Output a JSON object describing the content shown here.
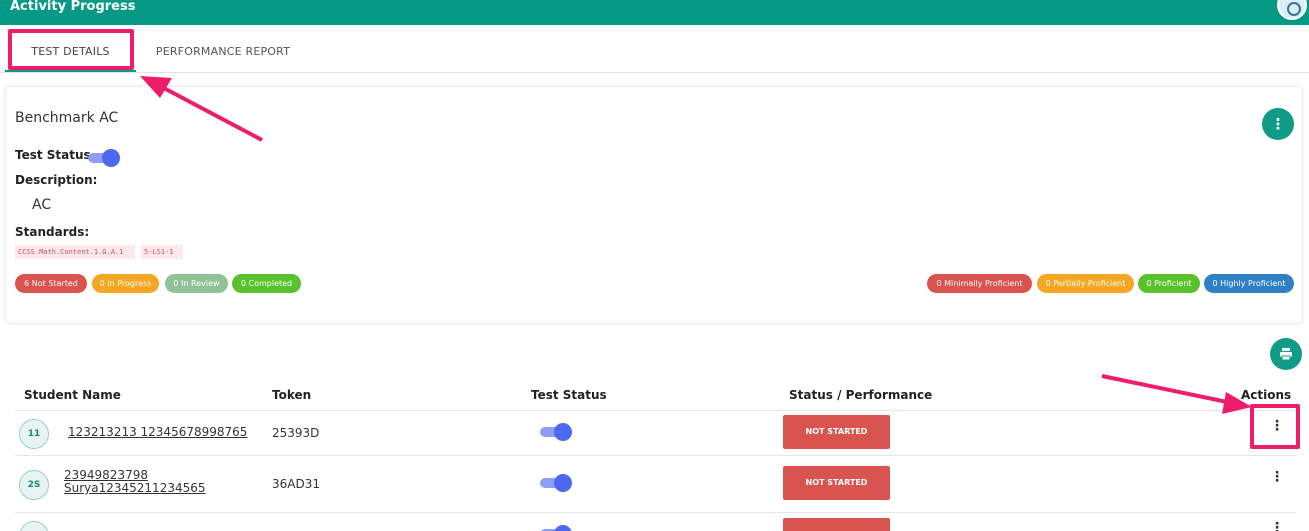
{
  "header": {
    "title": "Activity Progress",
    "avatar_icon": "user-avatar-icon"
  },
  "tabs": [
    {
      "label": "TEST DETAILS",
      "active": true
    },
    {
      "label": "PERFORMANCE REPORT",
      "active": false
    }
  ],
  "test": {
    "title": "Benchmark AC",
    "status_label": "Test Status",
    "status_on": true,
    "description_label": "Description:",
    "description": "AC",
    "standards_label": "Standards:",
    "standards": [
      "CCSS.Math.Content.1.G.A.1",
      "5-LS1-1"
    ]
  },
  "progress_badges": [
    "6 Not Started",
    "0 In Progress",
    "0 In Review",
    "0 Completed"
  ],
  "proficiency_badges": [
    "0 Minimally Proficient",
    "0 Partially Proficient",
    "0 Proficient",
    "0 Highly Proficient"
  ],
  "colors": {
    "accent": "#069a86",
    "not_started": "#d9534f",
    "in_progress": "#f5a623",
    "in_review": "#8fc397",
    "completed": "#57c22b",
    "highly_proficient": "#2f7fc4",
    "annotation": "#ee1d6b",
    "toggle": "#4f68f2"
  },
  "table": {
    "columns": [
      "Student Name",
      "Token",
      "Test Status",
      "Status / Performance",
      "Actions"
    ],
    "rows": [
      {
        "initials": "11",
        "name": "123213213 12345678998765",
        "token": "25393D",
        "test_status_on": true,
        "status": "NOT STARTED"
      },
      {
        "initials": "2S",
        "name": "23949823798 Surya12345211234565",
        "token": "36AD31",
        "test_status_on": true,
        "status": "NOT STARTED"
      },
      {
        "initials": "",
        "name": "",
        "token": "",
        "test_status_on": true,
        "status": ""
      }
    ]
  }
}
